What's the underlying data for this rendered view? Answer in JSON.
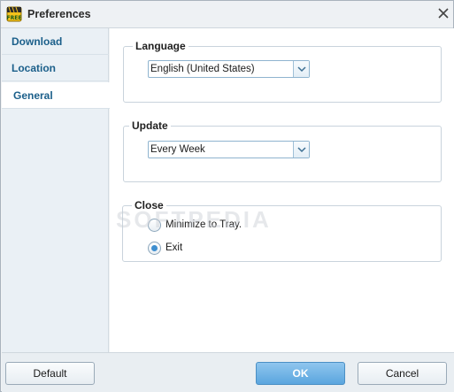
{
  "window": {
    "title": "Preferences",
    "app_icon": "free-app-icon",
    "close_icon": "close-icon"
  },
  "sidebar": {
    "items": [
      {
        "label": "Download",
        "active": false
      },
      {
        "label": "Location",
        "active": false
      },
      {
        "label": "General",
        "active": true
      }
    ]
  },
  "language": {
    "title": "Language",
    "selected": "English (United States)"
  },
  "update": {
    "title": "Update",
    "selected": "Every Week"
  },
  "close": {
    "title": "Close",
    "options": [
      {
        "label": "Minimize to Tray.",
        "checked": false
      },
      {
        "label": "Exit",
        "checked": true
      }
    ]
  },
  "watermark": "SOFTPEDIA",
  "footer": {
    "default_label": "Default",
    "ok_label": "OK",
    "cancel_label": "Cancel"
  },
  "colors": {
    "accent": "#1b5f8a",
    "primary_button": "#5aa5de"
  }
}
